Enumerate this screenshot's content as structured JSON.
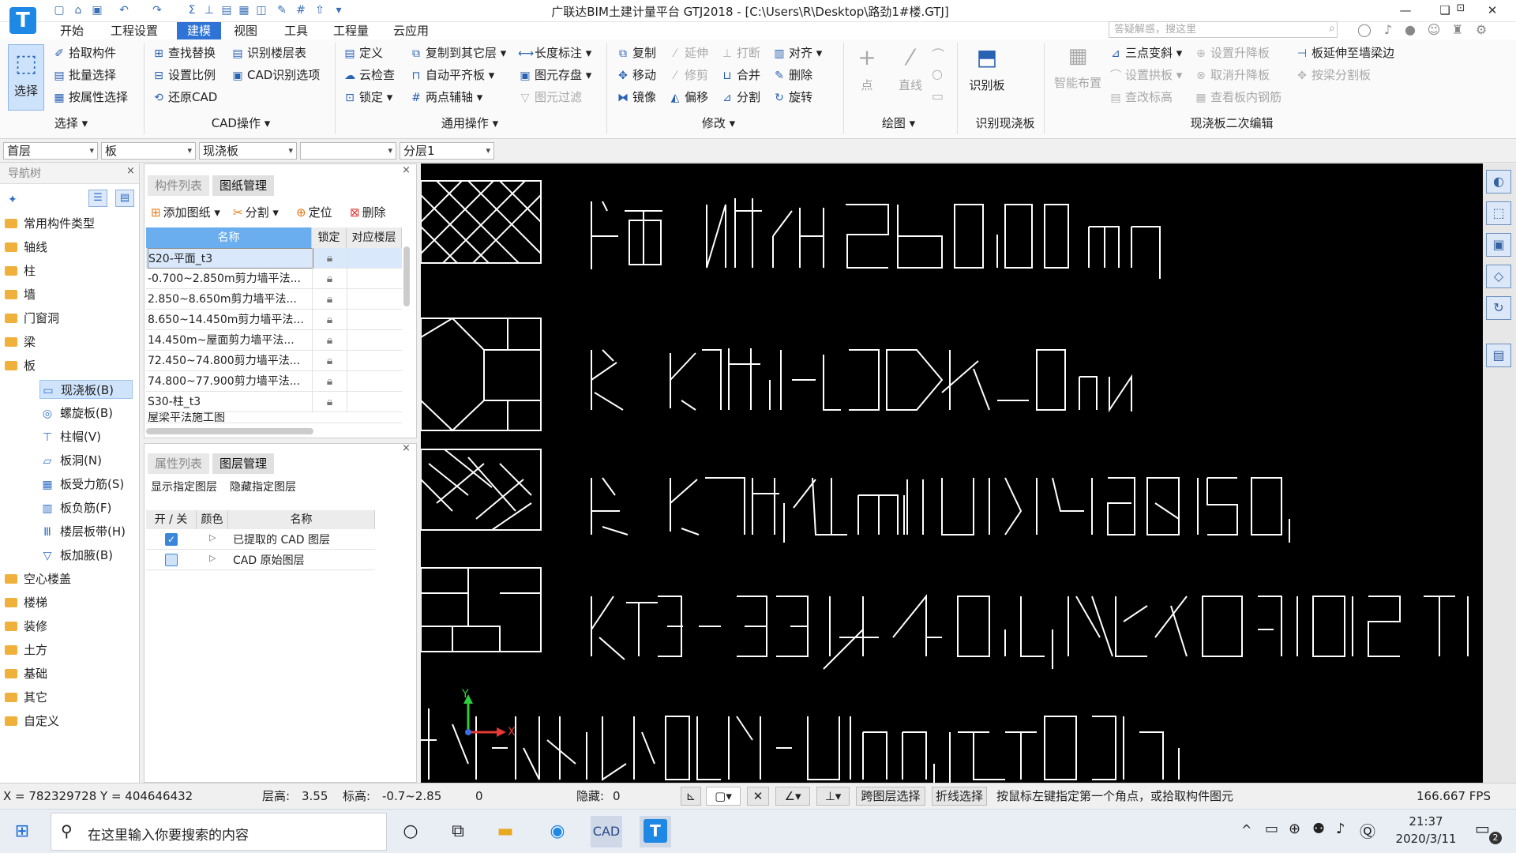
{
  "app": {
    "logo_letter": "T",
    "title": "广联达BIM土建计量平台 GTJ2018 - [C:\\Users\\R\\Desktop\\路劲1#楼.GTJ]",
    "search_placeholder": "答疑解惑，搜这里",
    "window_buttons": [
      "—",
      "❏",
      "✕"
    ]
  },
  "menu": {
    "tabs": [
      "开始",
      "工程设置",
      "建模",
      "视图",
      "工具",
      "工程量",
      "云应用"
    ],
    "active": "建模"
  },
  "ribbon": {
    "select": {
      "big_label": "选择",
      "items": [
        "拾取构件",
        "批量选择",
        "按属性选择"
      ],
      "group": "选择"
    },
    "cad": {
      "items": [
        "查找替换",
        "识别楼层表",
        "设置比例",
        "CAD识别选项",
        "还原CAD"
      ],
      "group": "CAD操作"
    },
    "common": {
      "items": [
        "定义",
        "复制到其它层",
        "长度标注",
        "云检查",
        "自动平齐板",
        "图元存盘",
        "锁定",
        "两点辅轴",
        "图元过滤"
      ],
      "group": "通用操作"
    },
    "modify": {
      "items": [
        "复制",
        "延伸",
        "打断",
        "对齐",
        "移动",
        "修剪",
        "合并",
        "删除",
        "镜像",
        "偏移",
        "分割",
        "旋转"
      ],
      "group": "修改"
    },
    "draw": {
      "items": [
        "点",
        "直线"
      ],
      "group": "绘图"
    },
    "recognize": {
      "big_label": "识别板",
      "group": "识别现浇板"
    },
    "edit2": {
      "big_label": "智能布置",
      "items": [
        "三点变斜",
        "设置升降板",
        "板延伸至墙梁边",
        "设置拱板",
        "取消升降板",
        "按梁分割板",
        "查改标高",
        "查看板内钢筋"
      ],
      "group": "现浇板二次编辑"
    }
  },
  "dropdowns": [
    "首层",
    "板",
    "现浇板",
    "",
    "分层1"
  ],
  "nav": {
    "title": "导航树",
    "items": [
      "常用构件类型",
      "轴线",
      "柱",
      "墙",
      "门窗洞",
      "梁",
      "板"
    ],
    "sub_items": [
      "现浇板(B)",
      "螺旋板(B)",
      "柱帽(V)",
      "板洞(N)",
      "板受力筋(S)",
      "板负筋(F)",
      "楼层板带(H)",
      "板加腋(B)"
    ],
    "sub_icons": [
      "slab-icon",
      "spiral-slab-icon",
      "column-cap-icon",
      "slab-hole-icon",
      "rebar-icon",
      "negative-rebar-icon",
      "floor-band-icon",
      "haunch-icon"
    ],
    "selected": "现浇板(B)",
    "more_items": [
      "空心楼盖",
      "楼梯",
      "装修",
      "土方",
      "基础",
      "其它",
      "自定义"
    ]
  },
  "drawings": {
    "tabs": [
      "构件列表",
      "图纸管理"
    ],
    "active_tab": "图纸管理",
    "toolbar": [
      "添加图纸",
      "分割",
      "定位",
      "删除"
    ],
    "columns": [
      "名称",
      "锁定",
      "对应楼层"
    ],
    "rows": [
      "S20-平面_t3",
      "-0.700~2.850m剪力墙平法...",
      "2.850~8.650m剪力墙平法...",
      "8.650~14.450m剪力墙平法...",
      "14.450m~屋面剪力墙平法...",
      "72.450~74.800剪力墙平法...",
      "74.800~77.900剪力墙平法...",
      "S30-柱_t3",
      "屋梁平法施工图"
    ]
  },
  "layers": {
    "tabs": [
      "属性列表",
      "图层管理"
    ],
    "active_tab": "图层管理",
    "actions": [
      "显示指定图层",
      "隐藏指定图层"
    ],
    "columns": [
      "开 / 关",
      "颜色",
      "名称"
    ],
    "rows": [
      "已提取的 CAD 图层",
      "CAD 原始图层"
    ]
  },
  "canvas": {
    "axis_x": "X",
    "axis_y": "Y"
  },
  "status": {
    "coords": "X = 782329728 Y = 404646432",
    "floor_height_label": "层高:",
    "floor_height": "3.55",
    "elevation_label": "标高:",
    "elevation": "-0.7~2.85",
    "count": "0",
    "hidden_label": "隐藏:",
    "hidden": "0",
    "btn_cross_layer": "跨图层选择",
    "btn_polyline": "折线选择",
    "hint": "按鼠标左键指定第一个角点，或拾取构件图元",
    "fps": "166.667 FPS"
  },
  "taskbar": {
    "search_placeholder": "在这里输入你要搜索的内容",
    "time": "21:37",
    "date": "2020/3/11",
    "notification_count": "2"
  }
}
